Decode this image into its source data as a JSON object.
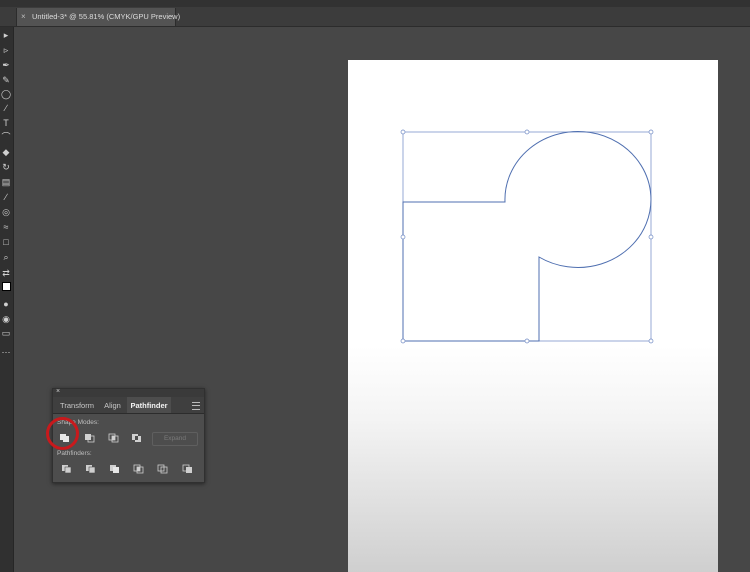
{
  "document": {
    "tab_close": "×",
    "tab_title": "Untitled-3* @ 55.81% (CMYK/GPU Preview)"
  },
  "toolbar": {
    "tools": [
      "selection-tool-icon",
      "direct-selection-tool-icon",
      "pen-tool-icon",
      "curvature-tool-icon",
      "ellipse-tool-icon",
      "paintbrush-tool-icon",
      "type-tool-icon",
      "lasso-tool-icon",
      "shaper-tool-icon",
      "rotate-tool-icon",
      "gradient-tool-icon",
      "eyedropper-tool-icon",
      "blend-tool-icon",
      "width-tool-icon",
      "artboard-tool-icon",
      "zoom-tool-icon",
      "swap-colors-icon",
      "fill-stroke-icon",
      "color-mode-icon",
      "draw-mode-icon",
      "screen-mode-icon",
      "more-tools-icon"
    ]
  },
  "pathfinder_panel": {
    "tabs": [
      {
        "label": "Transform",
        "active": false
      },
      {
        "label": "Align",
        "active": false
      },
      {
        "label": "Pathfinder",
        "active": true
      }
    ],
    "shape_modes_label": "Shape Modes:",
    "pathfinders_label": "Pathfinders:",
    "expand_label": "Expand",
    "shape_mode_buttons": [
      "unite-icon",
      "minus-front-icon",
      "intersect-icon",
      "exclude-icon"
    ],
    "pathfinder_buttons": [
      "divide-icon",
      "trim-icon",
      "merge-icon",
      "crop-icon",
      "outline-icon",
      "minus-back-icon"
    ]
  },
  "colors": {
    "selection_path": "#5a7ab8",
    "highlight_circle": "#c8191c"
  }
}
